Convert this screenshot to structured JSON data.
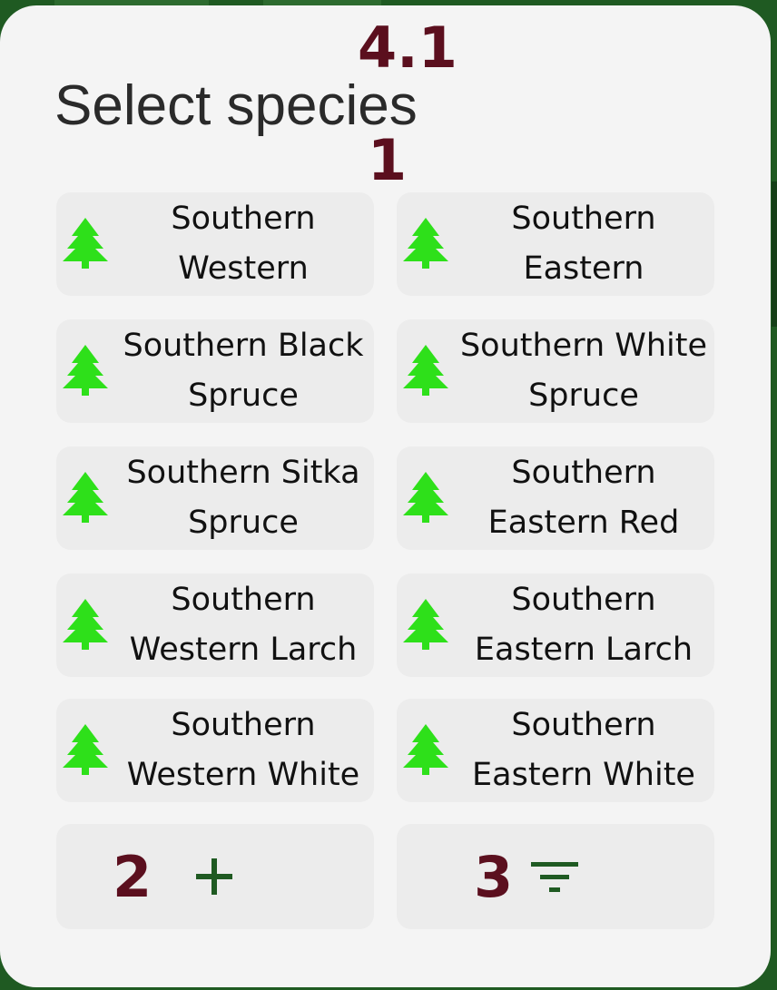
{
  "markers": {
    "m41": "4.1",
    "m1": "1",
    "m2": "2",
    "m3": "3"
  },
  "dialog": {
    "title": "Select species"
  },
  "species": [
    "Southern\nWestern",
    "Southern\nEastern",
    "Southern Black\nSpruce",
    "Southern White\nSpruce",
    "Southern Sitka\nSpruce",
    "Southern\nEastern Red",
    "Southern\nWestern Larch",
    "Southern\nEastern Larch",
    "Southern\nWestern White",
    "Southern\nEastern White"
  ],
  "icons": {
    "species": "evergreen-tree-icon",
    "add": "plus-icon",
    "filter": "filter-list-icon"
  },
  "colors": {
    "tree": "#2ee01a",
    "action_icon": "#1f5a22",
    "marker": "#5b0f1e",
    "dialog_bg": "#f4f4f4",
    "tile_bg": "#ececec"
  }
}
